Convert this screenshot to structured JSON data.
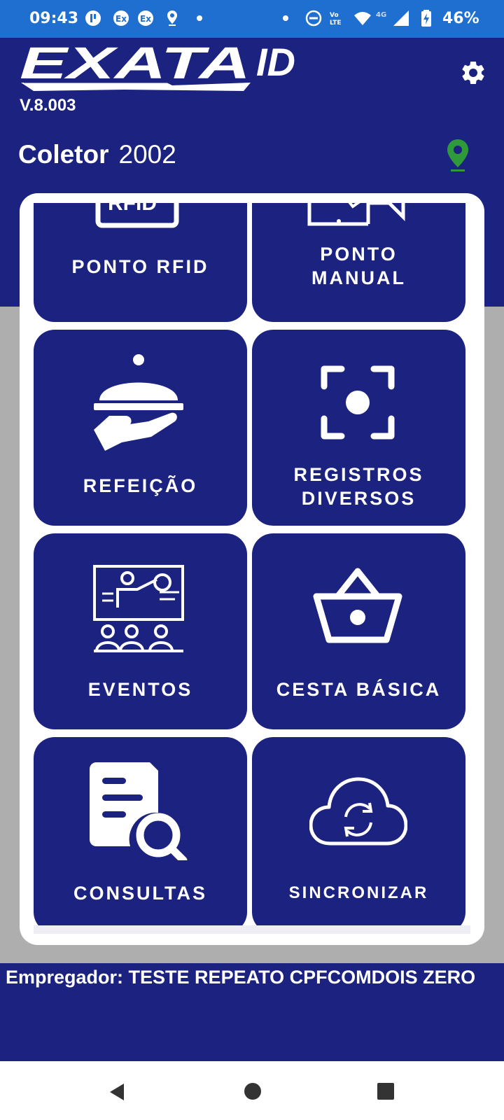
{
  "status_bar": {
    "time": "09:43",
    "battery": "46%",
    "icons": [
      "sync-icon",
      "exata-notification-icon",
      "exata-notification-icon",
      "location-icon",
      "dot-icon",
      "dot-icon",
      "do-not-disturb-icon",
      "volte-icon",
      "wifi-icon",
      "4g-icon",
      "signal-icon",
      "battery-charging-icon"
    ]
  },
  "header": {
    "logo_text": "EXATA",
    "logo_suffix": "ID",
    "version": "V.8.003",
    "settings_icon": "gear-icon",
    "collector_label": "Coletor",
    "collector_value": "2002",
    "location_icon": "location-pin-icon",
    "location_color": "#2e9a3a"
  },
  "menu": {
    "tiles": [
      {
        "id": "ponto-rfid",
        "label": "PONTO RFID",
        "icon": "rfid-icon"
      },
      {
        "id": "ponto-manual",
        "label": "PONTO\nMANUAL",
        "icon": "manual-entry-icon"
      },
      {
        "id": "refeicao",
        "label": "REFEIÇÃO",
        "icon": "meal-tray-icon"
      },
      {
        "id": "registros-diversos",
        "label": "REGISTROS\nDIVERSOS",
        "icon": "focus-camera-icon"
      },
      {
        "id": "eventos",
        "label": "EVENTOS",
        "icon": "presentation-icon"
      },
      {
        "id": "cesta-basica",
        "label": "CESTA BÁSICA",
        "icon": "basket-icon"
      },
      {
        "id": "consultas",
        "label": "CONSULTAS",
        "icon": "document-search-icon"
      },
      {
        "id": "sincronizar",
        "label": "SINCRONIZAR",
        "icon": "cloud-sync-icon"
      }
    ]
  },
  "footer": {
    "employer_label": "Empregador:",
    "employer_value": "TESTE REPEATO CPFCOMDOIS ZERO"
  },
  "navigation": {
    "back": "back-icon",
    "home": "home-icon",
    "recents": "recents-icon"
  },
  "colors": {
    "primary": "#1b2280",
    "status_bar": "#1e6fd0",
    "background": "#aeaeae",
    "card": "#ffffff"
  }
}
